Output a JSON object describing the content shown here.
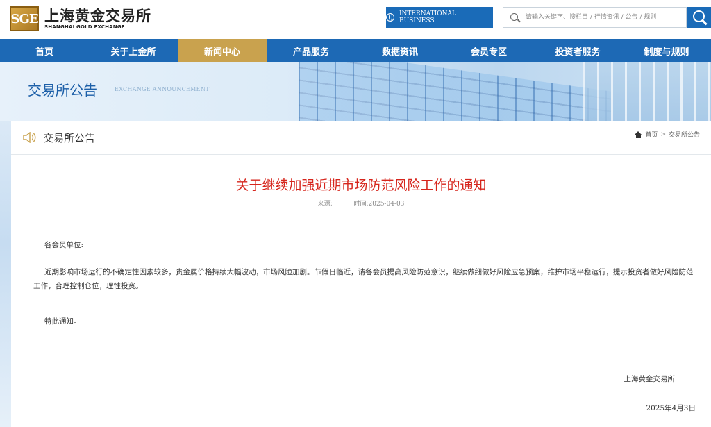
{
  "header": {
    "logo_mark": "SGE",
    "logo_cn": "上海黄金交易所",
    "logo_en": "SHANGHAI GOLD EXCHANGE",
    "intl_label": "INTERNATIONAL BUSINESS",
    "search_placeholder": "请输入关键字、搜栏目 / 行情资讯 / 公告 / 规则"
  },
  "nav": {
    "items": [
      {
        "label": "首页"
      },
      {
        "label": "关于上金所"
      },
      {
        "label": "新闻中心"
      },
      {
        "label": "产品服务"
      },
      {
        "label": "数据资讯"
      },
      {
        "label": "会员专区"
      },
      {
        "label": "投资者服务"
      },
      {
        "label": "制度与规则"
      }
    ],
    "active_index": 2
  },
  "banner": {
    "title": "交易所公告",
    "subtitle": "EXCHANGE ANNOUNCEMENT"
  },
  "section": {
    "title": "交易所公告",
    "breadcrumb": [
      "首页",
      "交易所公告"
    ]
  },
  "article": {
    "title": "关于继续加强近期市场防范风险工作的通知",
    "source_label": "来源:",
    "time_label": "时间:2025-04-03",
    "salutation": "各会员单位:",
    "paragraph": "近期影响市场运行的不确定性因素较多，贵金属价格持续大幅波动，市场风险加剧。节假日临近，请各会员提高风险防范意识，继续做细做好风险应急预案，维护市场平稳运行，提示投资者做好风险防范工作，合理控制仓位，理性投资。",
    "closing": "特此通知。",
    "signature": "上海黄金交易所",
    "date": "2025年4月3日"
  },
  "colors": {
    "primary_blue": "#1d69b5",
    "active_gold": "#c9a24e",
    "title_red": "#d6251c"
  }
}
